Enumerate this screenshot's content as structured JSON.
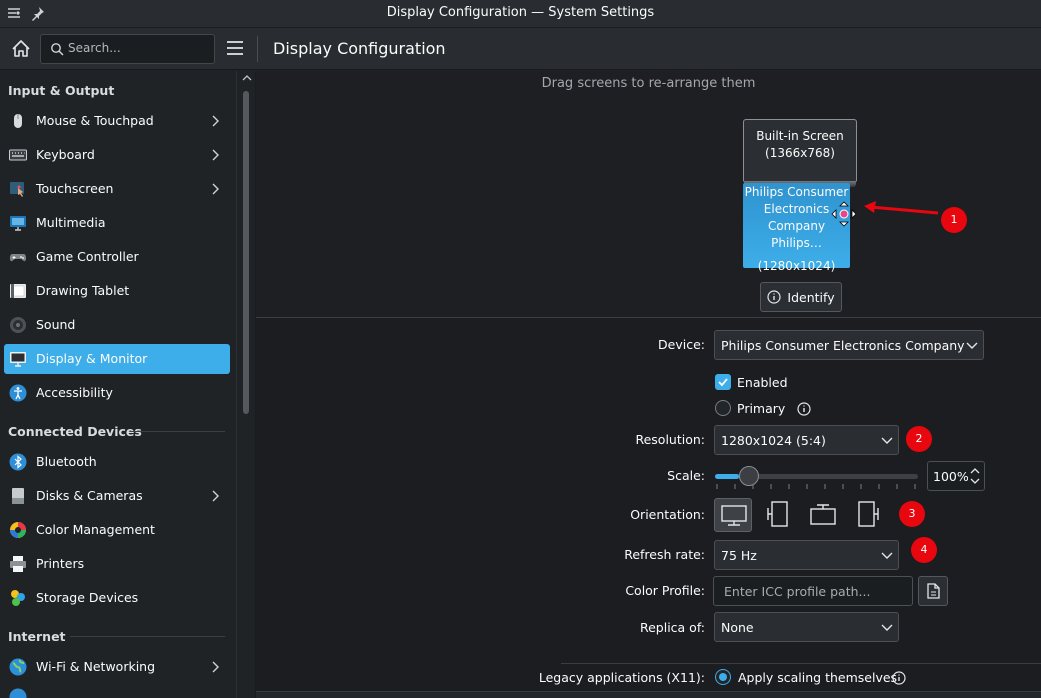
{
  "window": {
    "title": "Display Configuration — System Settings"
  },
  "toolbar": {
    "search_placeholder": "Search...",
    "page_title": "Display Configuration"
  },
  "sidebar": {
    "sections": [
      {
        "header": "Input & Output",
        "items": [
          {
            "label": "Mouse & Touchpad",
            "icon": "mouse-icon",
            "has_children": true
          },
          {
            "label": "Keyboard",
            "icon": "keyboard-icon",
            "has_children": true
          },
          {
            "label": "Touchscreen",
            "icon": "touchscreen-icon",
            "has_children": true
          },
          {
            "label": "Multimedia",
            "icon": "multimedia-icon",
            "has_children": false
          },
          {
            "label": "Game Controller",
            "icon": "gamepad-icon",
            "has_children": false
          },
          {
            "label": "Drawing Tablet",
            "icon": "tablet-icon",
            "has_children": false
          },
          {
            "label": "Sound",
            "icon": "speaker-icon",
            "has_children": false
          },
          {
            "label": "Display & Monitor",
            "icon": "monitor-icon",
            "has_children": false,
            "selected": true
          },
          {
            "label": "Accessibility",
            "icon": "accessibility-icon",
            "has_children": false
          }
        ]
      },
      {
        "header": "Connected Devices",
        "items": [
          {
            "label": "Bluetooth",
            "icon": "bluetooth-icon",
            "has_children": false
          },
          {
            "label": "Disks & Cameras",
            "icon": "disk-icon",
            "has_children": true
          },
          {
            "label": "Color Management",
            "icon": "color-wheel-icon",
            "has_children": false
          },
          {
            "label": "Printers",
            "icon": "printer-icon",
            "has_children": false
          },
          {
            "label": "Storage Devices",
            "icon": "storage-icon",
            "has_children": false
          }
        ]
      },
      {
        "header": "Internet",
        "items": [
          {
            "label": "Wi-Fi & Networking",
            "icon": "globe-icon",
            "has_children": true
          }
        ]
      }
    ]
  },
  "arrange": {
    "hint": "Drag screens to re-arrange them",
    "builtin": {
      "line1": "Built-in Screen",
      "line2": "(1366x768)"
    },
    "philips": {
      "line1": "Philips Consumer",
      "line2": "Electronics",
      "line3": "Company Philips…",
      "line4": "(1280x1024)"
    },
    "identify_label": "Identify"
  },
  "annotations": [
    "1",
    "2",
    "3",
    "4"
  ],
  "form": {
    "device_label": "Device:",
    "device_value": "Philips Consumer Electronics Company Phil",
    "enabled_label": "Enabled",
    "enabled_checked": true,
    "primary_label": "Primary",
    "primary_checked": false,
    "resolution_label": "Resolution:",
    "resolution_value": "1280x1024 (5:4)",
    "scale_label": "Scale:",
    "scale_value": "100%",
    "scale_fraction": 0.12,
    "orientation_label": "Orientation:",
    "orientation_selected": 0,
    "refresh_label": "Refresh rate:",
    "refresh_value": "75 Hz",
    "color_profile_label": "Color Profile:",
    "color_profile_placeholder": "Enter ICC profile path...",
    "replica_label": "Replica of:",
    "replica_value": "None",
    "legacy_label": "Legacy applications (X11):",
    "legacy_option": "Apply scaling themselves",
    "legacy_checked": true
  },
  "colors": {
    "accent": "#3daee9",
    "annotation": "#e8060f",
    "background": "#202326"
  }
}
